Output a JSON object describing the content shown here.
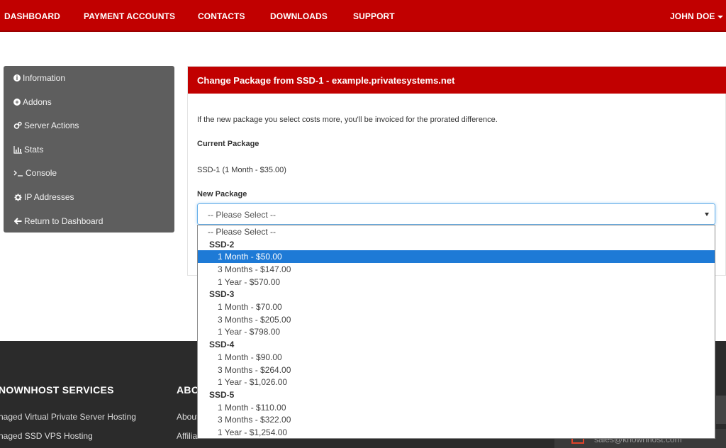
{
  "nav": {
    "items": [
      "DASHBOARD",
      "PAYMENT ACCOUNTS",
      "CONTACTS",
      "DOWNLOADS",
      "SUPPORT"
    ],
    "user": "JOHN DOE"
  },
  "sidebar": {
    "items": [
      {
        "label": "Information",
        "icon": "info-circle-icon"
      },
      {
        "label": "Addons",
        "icon": "plus-circle-icon"
      },
      {
        "label": "Server Actions",
        "icon": "cogs-icon"
      },
      {
        "label": "Stats",
        "icon": "bar-chart-icon"
      },
      {
        "label": "Console",
        "icon": "terminal-icon"
      },
      {
        "label": "IP Addresses",
        "icon": "gear-icon"
      },
      {
        "label": "Return to Dashboard",
        "icon": "arrow-left-icon"
      }
    ]
  },
  "panel": {
    "title": "Change Package from SSD-1 - example.privatesystems.net",
    "notice": "If the new package you select costs more, you'll be invoiced for the prorated difference.",
    "current_label": "Current Package",
    "current_value": "SSD-1 (1 Month - $35.00)",
    "new_label": "New Package",
    "select_value": "-- Please Select --"
  },
  "dropdown": {
    "placeholder": "-- Please Select --",
    "groups": [
      {
        "name": "SSD-2",
        "options": [
          "1 Month - $50.00",
          "3 Months - $147.00",
          "1 Year - $570.00"
        ]
      },
      {
        "name": "SSD-3",
        "options": [
          "1 Month - $70.00",
          "3 Months - $205.00",
          "1 Year - $798.00"
        ]
      },
      {
        "name": "SSD-4",
        "options": [
          "1 Month - $90.00",
          "3 Months - $264.00",
          "1 Year - $1,026.00"
        ]
      },
      {
        "name": "SSD-5",
        "options": [
          "1 Month - $110.00",
          "3 Months - $322.00",
          "1 Year - $1,254.00"
        ]
      }
    ],
    "highlighted": "1 Month - $50.00"
  },
  "footer": {
    "heading_services": "NOWNHOST SERVICES",
    "heading_about": "ABO",
    "links_services": [
      "naged Virtual Private Server Hosting",
      "naged SSD VPS Hosting"
    ],
    "links_about": [
      "About",
      "Affilia"
    ],
    "email_partial": "sales@knownhost.com"
  },
  "colors": {
    "brand_red": "#c10000",
    "sidebar_gray": "#5e5e5e",
    "highlight_blue": "#1e7ad6",
    "footer_dark": "#2b2b2b"
  }
}
